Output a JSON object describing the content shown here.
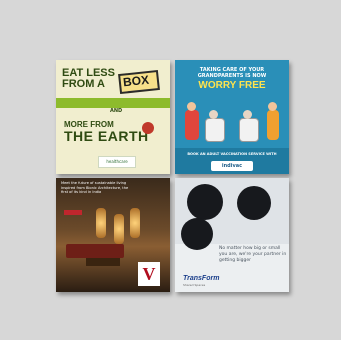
{
  "poster1": {
    "line1": "EAT LESS FROM A",
    "box_word": "BOX",
    "and": "AND",
    "line2": "MORE FROM",
    "line3": "THE EARTH",
    "brand": "healthcare"
  },
  "poster2": {
    "line1": "TAKING CARE OF YOUR GRANDPARENTS IS NOW",
    "line2": "WORRY FREE",
    "banner": "BOOK AN ADULT VACCINATION SERVICE WITH",
    "brand": "indivac"
  },
  "poster3": {
    "text": "Meet the future of sustainable living inspired from Bionic Architecture, the first of its kind in India",
    "logo": "V"
  },
  "poster4": {
    "text": "No matter how big or small you are, we're your partner in getting bigger",
    "brand": "TransForm",
    "tagline": "Shared Spaces"
  }
}
